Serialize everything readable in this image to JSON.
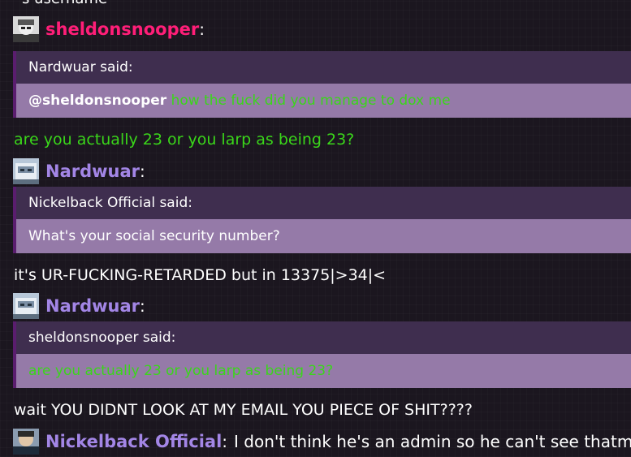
{
  "chat": {
    "cut_top_text": "'s username",
    "messages": [
      {
        "author": "sheldonsnooper",
        "quote_author_line": "Nardwuar said:",
        "quote_mention": "@sheldonsnooper",
        "quote_text": "how the fuck did you manage to dox me",
        "text": "are you actually 23 or you larp as being 23?"
      },
      {
        "author": "Nardwuar",
        "quote_author_line": "Nickelback Official said:",
        "quote_text": "What's your social security number?",
        "text": "it's UR-FUCKING-RETARDED but in 13375|>34|<"
      },
      {
        "author": "Nardwuar",
        "quote_author_line": "sheldonsnooper said:",
        "quote_text": "are you actually 23 or you larp as being 23?",
        "text": "wait YOU DIDNT LOOK AT MY EMAIL YOU PIECE OF SHIT????"
      },
      {
        "author": "Nickelback Official",
        "text": "I don't think he's an admin so he can't see thatm"
      }
    ],
    "colon": ":"
  },
  "colors": {
    "sheldonsnooper_name": "#ff1e78",
    "nardwuar_name": "#a386e6",
    "nickelback_name": "#a386e6",
    "green_text": "#3ad61a",
    "quote_head_bg": "#3f2e4f",
    "quote_body_bg": "#957aa8",
    "quote_border": "#5a1d6e"
  }
}
